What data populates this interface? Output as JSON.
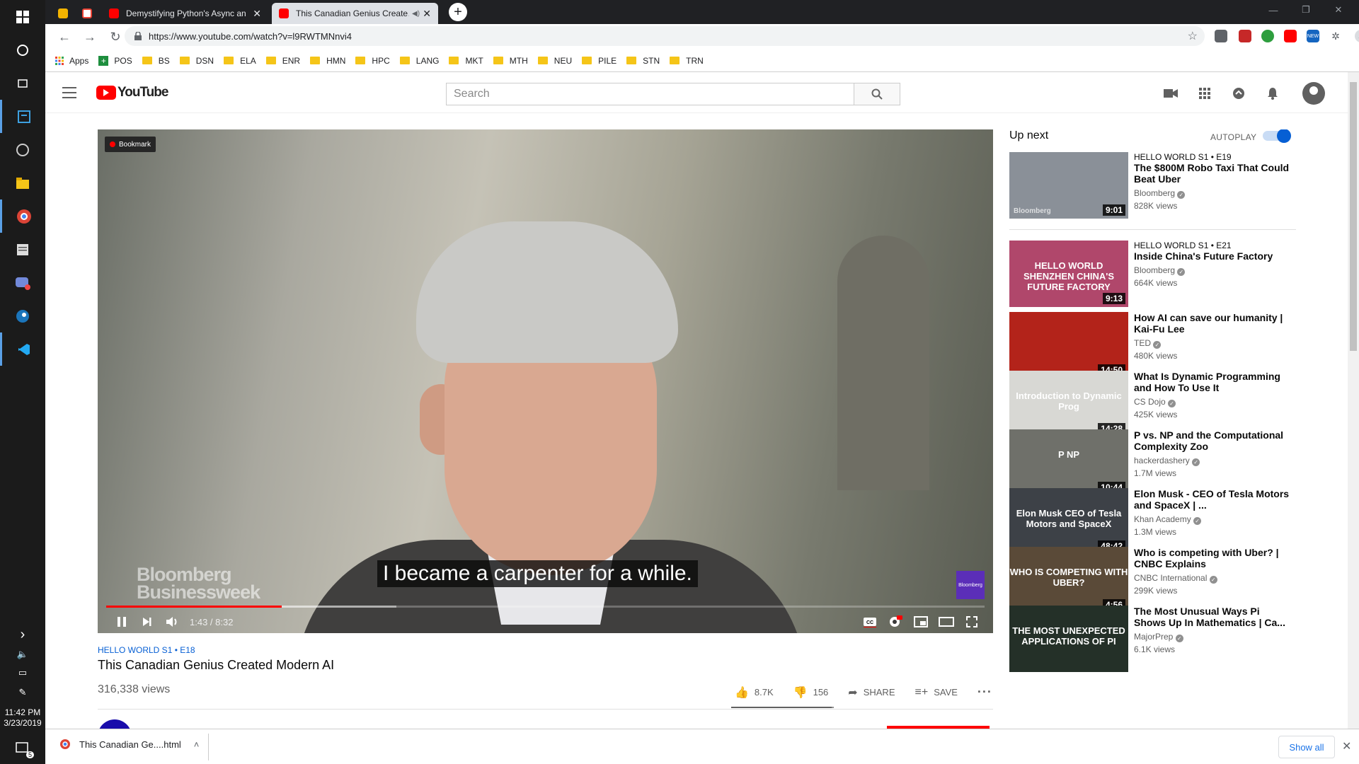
{
  "windows": {
    "time": "11:42 PM",
    "date": "3/23/2019",
    "notification_count": "5"
  },
  "browser": {
    "tabs": [
      {
        "label": "",
        "favicon_color": "#f4b400"
      },
      {
        "label": "",
        "favicon_color": "#ea4335"
      },
      {
        "label": "Demystifying Python's Async and…",
        "favicon_color": "#ff0000"
      },
      {
        "label": "This Canadian Genius Create…",
        "favicon_color": "#ff0000"
      }
    ],
    "url": "https://www.youtube.com/watch?v=l9RWTMNnvi4",
    "bookmarks": [
      "Apps",
      "POS",
      "BS",
      "DSN",
      "ELA",
      "ENR",
      "HMN",
      "HPC",
      "LANG",
      "MKT",
      "MTH",
      "NEU",
      "PILE",
      "STN",
      "TRN"
    ]
  },
  "youtube": {
    "logo_text": "YouTube",
    "search_placeholder": "Search",
    "player": {
      "bookmark_badge": "Bookmark",
      "watermark_line1": "Bloomberg",
      "watermark_line2": "Businessweek",
      "channel_logo": "Bloomberg",
      "caption": "I became a carpenter for a while.",
      "time": "1:43 / 8:32",
      "played_fraction": 0.2,
      "buffered_fraction": 0.33,
      "accent_color": "#ff0000"
    },
    "video": {
      "series": "HELLO WORLD  S1 • E18",
      "title": "This Canadian Genius Created Modern AI",
      "views": "316,338 views",
      "likes": "8.7K",
      "dislikes": "156",
      "share_label": "SHARE",
      "save_label": "SAVE",
      "like_fraction": 0.98
    },
    "sidebar": {
      "up_next": "Up next",
      "autoplay": "AUTOPLAY",
      "items": [
        {
          "series": "HELLO WORLD  S1 • E19",
          "title": "The $800M Robo Taxi That Could Beat Uber",
          "channel": "Bloomberg",
          "views": "828K views",
          "duration": "9:01",
          "thumb_text": "Bloomberg",
          "thumb_color": "#8a9098"
        },
        {
          "series": "HELLO WORLD  S1 • E21",
          "title": "Inside China's Future Factory",
          "channel": "Bloomberg",
          "views": "664K views",
          "duration": "9:13",
          "thumb_text": "HELLO WORLD SHENZHEN CHINA'S FUTURE FACTORY",
          "thumb_color": "#b0476b"
        },
        {
          "series": "",
          "title": "How AI can save our humanity | Kai-Fu Lee",
          "channel": "TED",
          "views": "480K views",
          "duration": "14:50",
          "thumb_text": "",
          "thumb_color": "#b3231a"
        },
        {
          "series": "",
          "title": "What Is Dynamic Programming and How To Use It",
          "channel": "CS Dojo",
          "views": "425K views",
          "duration": "14:28",
          "thumb_text": "Introduction to Dynamic Prog",
          "thumb_color": "#d8d8d4"
        },
        {
          "series": "",
          "title": "P vs. NP and the Computational Complexity Zoo",
          "channel": "hackerdashery",
          "views": "1.7M views",
          "duration": "10:44",
          "thumb_text": "P  NP",
          "thumb_color": "#6f706a"
        },
        {
          "series": "",
          "title": "Elon Musk - CEO of Tesla Motors and SpaceX | ...",
          "channel": "Khan Academy",
          "views": "1.3M views",
          "duration": "48:42",
          "thumb_text": "Elon Musk CEO of Tesla Motors and SpaceX",
          "thumb_color": "#3d4147"
        },
        {
          "series": "",
          "title": "Who is competing with Uber? | CNBC Explains",
          "channel": "CNBC International",
          "views": "299K views",
          "duration": "4:56",
          "thumb_text": "WHO IS COMPETING WITH UBER?",
          "thumb_color": "#5a4a38"
        },
        {
          "series": "",
          "title": "The Most Unusual Ways Pi Shows Up In Mathematics | Ca...",
          "channel": "MajorPrep",
          "views": "6.1K views",
          "duration": "",
          "thumb_text": "THE MOST UNEXPECTED APPLICATIONS OF PI",
          "thumb_color": "#243028"
        }
      ]
    }
  },
  "downloads": {
    "file": "This Canadian Ge....html",
    "show_all": "Show all"
  }
}
